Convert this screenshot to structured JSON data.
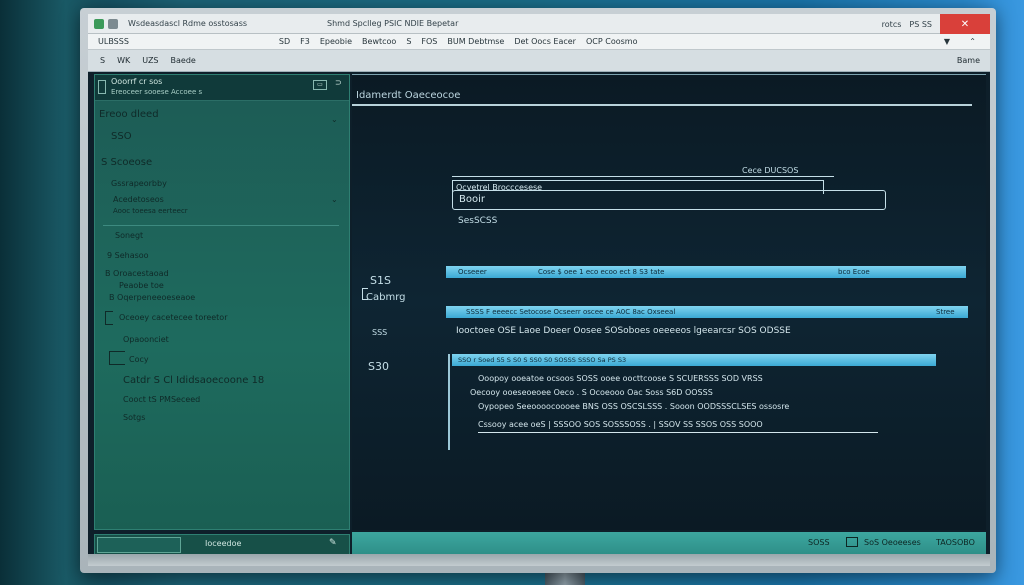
{
  "window": {
    "app_title": "Wsdeasdascl Rdme osstosass",
    "titlebar_mid": "Shmd Spclleg   PSIC   NDIE Bepetar",
    "titlebar_right": "rotcs",
    "titlebar_right2": "PS  SS",
    "menu_left": "ULBSSS",
    "menu_items": [
      "SD",
      "F3",
      "Epeobie",
      "Bewtcoo",
      "S",
      "FOS",
      "BUM Debtmse",
      "Det Oocs Eacer",
      "OCP Coosmo"
    ],
    "toolbar_items": [
      "S",
      "WK",
      "UZS",
      "Baede"
    ],
    "toolbar_right": "Bame"
  },
  "sidebar": {
    "header_line1": "Ooorrf cr sos",
    "header_line2": "Ereoceer sooese Accoee s",
    "items": [
      {
        "label": "Ereoo dleed"
      },
      {
        "label": "SSO"
      },
      {
        "label": "S Scoeose"
      },
      {
        "label": "Gssrapeorbby"
      },
      {
        "label": "Acedetoseos"
      },
      {
        "label": "Aooc toeesa eerteecr"
      },
      {
        "label": "Sonegt"
      },
      {
        "label": "9  Sehasoo"
      },
      {
        "label": "B  Oroacestaoad"
      },
      {
        "label": "Peaobe toe"
      },
      {
        "label": "B  Oqerpeneeoeseaoe"
      },
      {
        "label": "Oceoey cacetecee toreetor"
      },
      {
        "label": "Opaoonciet"
      },
      {
        "label": "Cocy"
      },
      {
        "label": "Catdr  S Cl Ididsaoecoone  18"
      },
      {
        "label": "Cooct  tS  PMSeceed"
      },
      {
        "label": "Sotgs"
      }
    ],
    "footer_label": "Ioceedoe"
  },
  "main": {
    "title": "Idamerdt  Oaeceocoe",
    "link_right": "Cece  DUCSOS",
    "field1_label": "Ocvetrel  Brocccesese",
    "field2_value": "Booir",
    "field_hint": "SesSCSS",
    "left_labels": {
      "a": "S1S",
      "b": "Cabmrg",
      "c": "SSS",
      "d": "S30"
    },
    "bar1": {
      "left": "Ocseeer",
      "mid": "Cose  $ oee  1 eco  ecoo  ect  8 S3  tate",
      "right": "bco  Ecoe"
    },
    "bar2": {
      "left": "SSSS  F eeeecc  Setocose  Ocseerr  oscee  ce  A0C  8ac  Oxseeal",
      "right": "Stree"
    },
    "row1": "Iooctoee  OSE   Laoe  Doeer   Oosee SOSoboes   oeeeeos  lgeearcsr  SOS ODSSE",
    "bar3": "SSO  r  Soed  S5  S S0  S  SS0  S0      SOSSS SSSO  Sa  PS                  S3",
    "row2": "Ooopoy  ooeatoe  ocsoos  SOSS    ooee  oocttcoose  S SCUERSSS  SOD   VRSS",
    "row3": "Oecooy  ooeseoeoee  Oeco  .  S Ocoeooo  Oac  Soss S6D  OOSSS",
    "row4": "Oypopeo  Seeoooocoooee  BNS  OSS  OSCSLSSS  .  Sooon  OODSSSCLSES  ossosre",
    "row5": "Cssooy  acee  oeS  |  SSSOO  SOS  SOSSSOSS  .  |  SSOV  SS  SSOS  OSS  SOOO"
  },
  "statusbar": {
    "item1": "SOSS",
    "item2": "SoS  Oeoeeses",
    "item3": "TAOSOBO"
  }
}
